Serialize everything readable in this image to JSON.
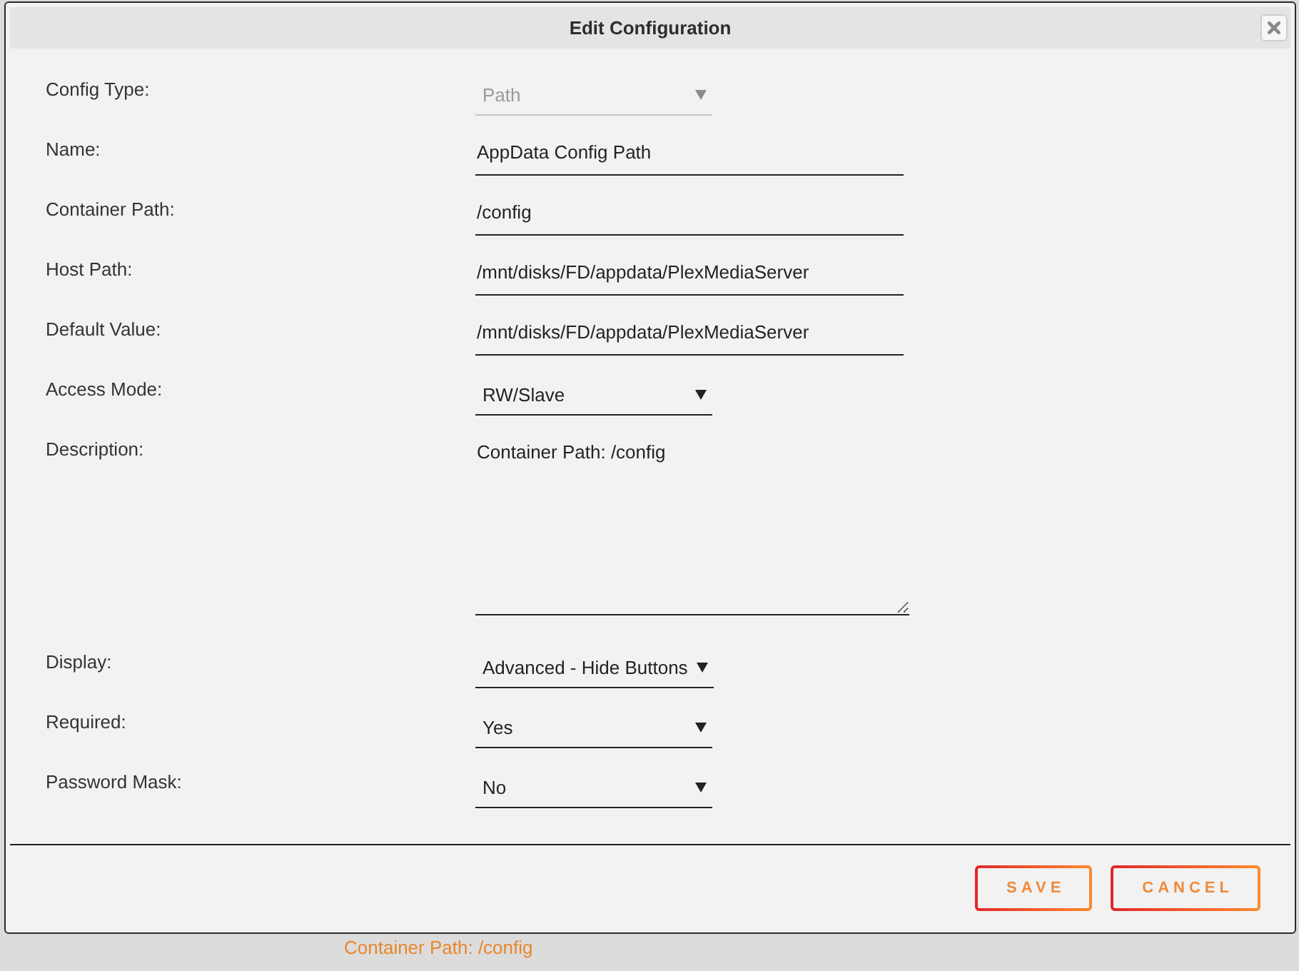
{
  "dialog": {
    "title": "Edit Configuration"
  },
  "fields": [
    {
      "label": "Config Type:",
      "kind": "select",
      "value": "Path",
      "disabled": true
    },
    {
      "label": "Name:",
      "kind": "text",
      "value": "AppData Config Path",
      "disabled": false
    },
    {
      "label": "Container Path:",
      "kind": "text",
      "value": "/config",
      "disabled": false
    },
    {
      "label": "Host Path:",
      "kind": "text",
      "value": "/mnt/disks/FD/appdata/PlexMediaServer",
      "disabled": false
    },
    {
      "label": "Default Value:",
      "kind": "text",
      "value": "/mnt/disks/FD/appdata/PlexMediaServer",
      "disabled": false
    },
    {
      "label": "Access Mode:",
      "kind": "select",
      "value": "RW/Slave",
      "disabled": false
    },
    {
      "label": "Description:",
      "kind": "textarea",
      "value": "Container Path: /config",
      "disabled": false
    },
    {
      "label": "Display:",
      "kind": "select",
      "value": "Advanced - Hide Buttons",
      "disabled": false
    },
    {
      "label": "Required:",
      "kind": "select",
      "value": "Yes",
      "disabled": false
    },
    {
      "label": "Password Mask:",
      "kind": "select",
      "value": "No",
      "disabled": false
    }
  ],
  "buttons": [
    {
      "label": "SAVE"
    },
    {
      "label": "CANCEL"
    }
  ],
  "background_page": {
    "text": "Container Path: /config"
  }
}
